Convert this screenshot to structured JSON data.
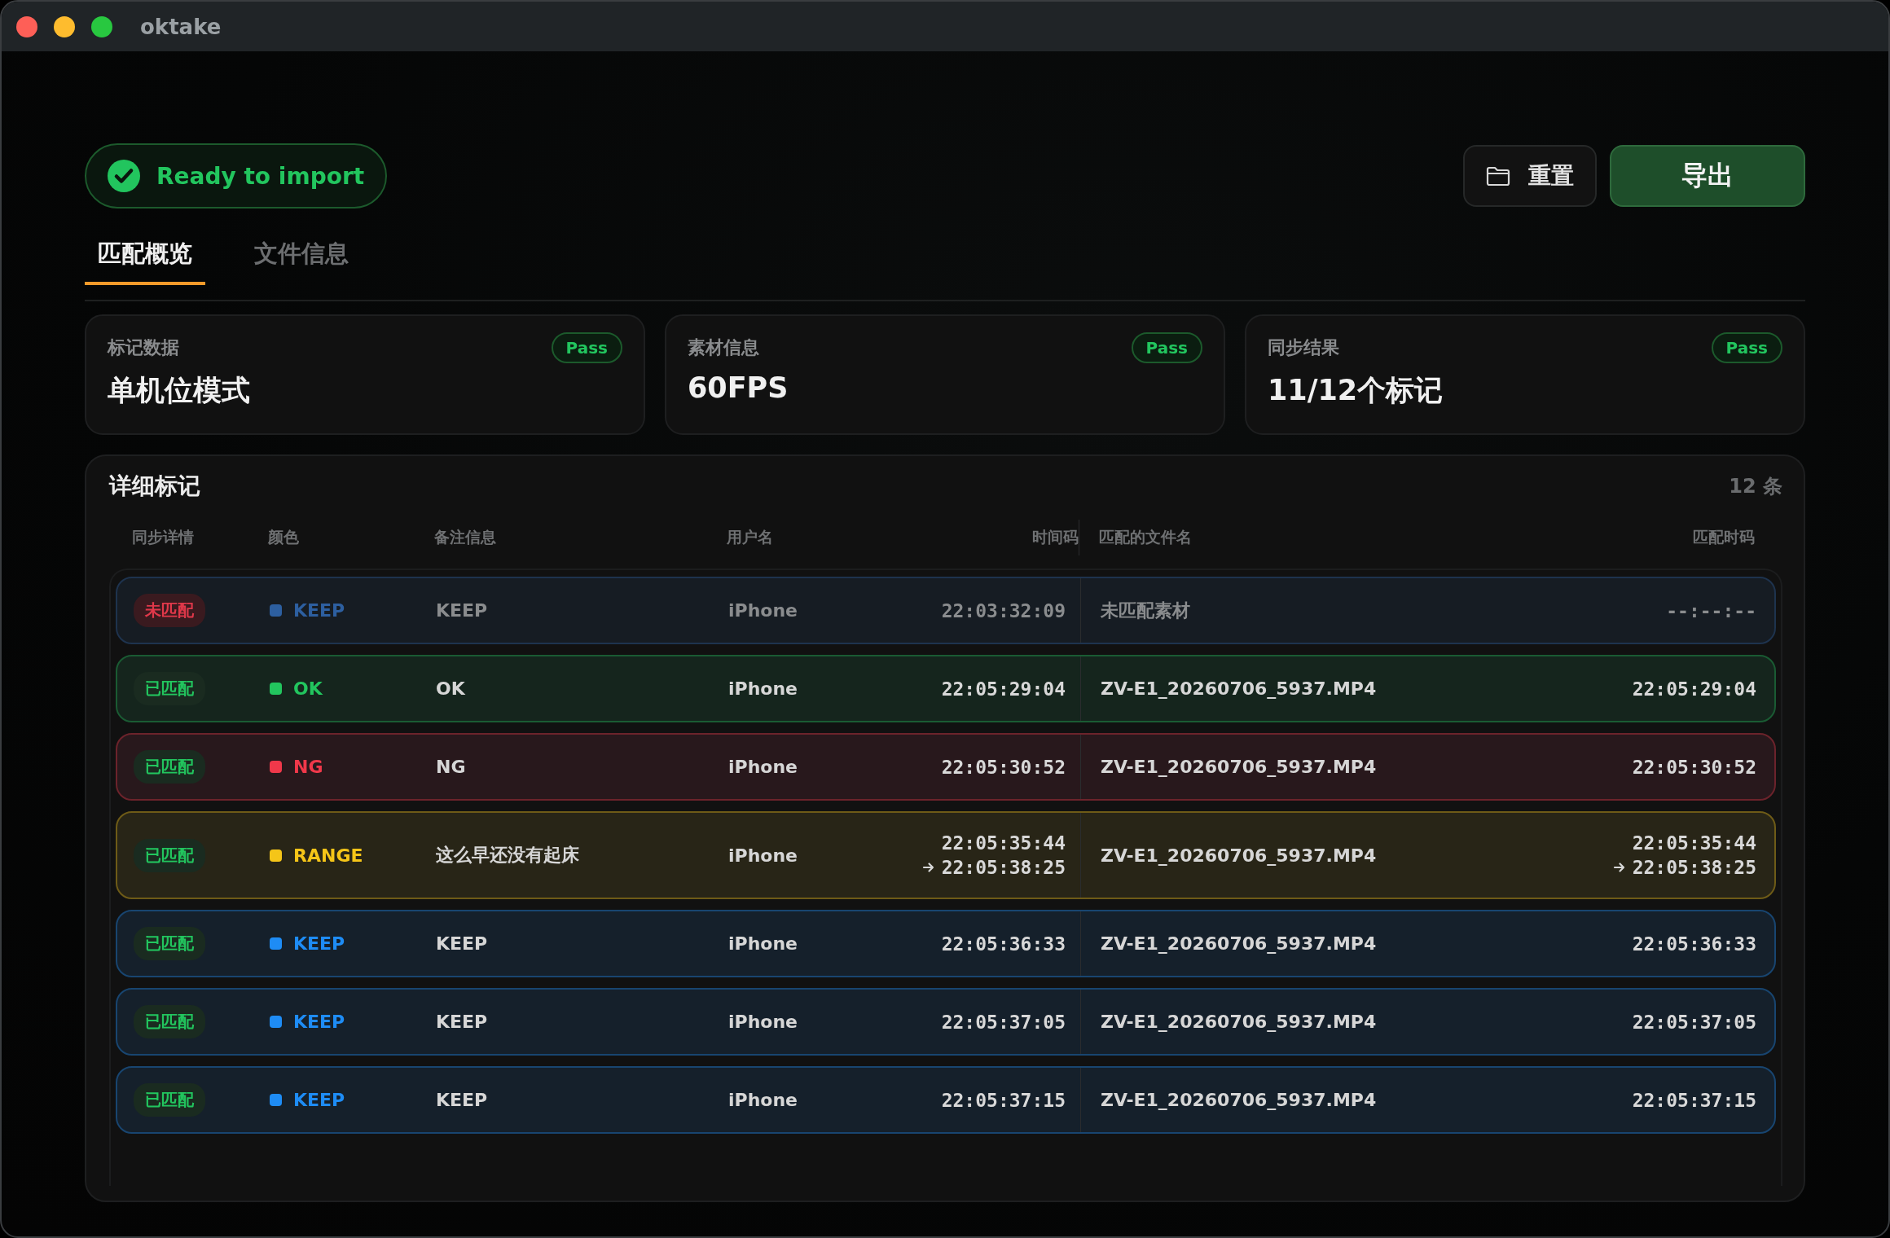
{
  "window": {
    "title": "oktake"
  },
  "status": {
    "label": "Ready to import"
  },
  "actions": [
    {
      "label": "重置",
      "kind": "secondary"
    },
    {
      "label": "导出",
      "kind": "primary"
    }
  ],
  "tabs": [
    {
      "label": "匹配概览",
      "selected": true
    },
    {
      "label": "文件信息",
      "selected": false
    }
  ],
  "summary_cards": [
    {
      "label": "标记数据",
      "badge": "Pass",
      "value": "单机位模式"
    },
    {
      "label": "素材信息",
      "badge": "Pass",
      "value": "60FPS"
    },
    {
      "label": "同步结果",
      "badge": "Pass",
      "value": "11/12个标记"
    }
  ],
  "markers": {
    "title": "详细标记",
    "count": "12 条",
    "columns": [
      "同步详情",
      "颜色",
      "备注信息",
      "用户名",
      "时间码",
      "匹配的文件名",
      "匹配时码"
    ],
    "rows": [
      {
        "sync": "未匹配",
        "matched": false,
        "color": "#2d5fa0",
        "color_label": "KEEP",
        "note": "KEEP",
        "user": "iPhone",
        "timecode": "22:03:32:09",
        "file": "未匹配素材",
        "matched_timecode": "--:--:--"
      },
      {
        "sync": "已匹配",
        "matched": true,
        "color": "#22c55e",
        "color_label": "OK",
        "note": "OK",
        "user": "iPhone",
        "timecode": "22:05:29:04",
        "file": "ZV-E1_20260706_5937.MP4",
        "matched_timecode": "22:05:29:04"
      },
      {
        "sync": "已匹配",
        "matched": true,
        "color": "#f0384a",
        "color_label": "NG",
        "note": "NG",
        "user": "iPhone",
        "timecode": "22:05:30:52",
        "file": "ZV-E1_20260706_5937.MP4",
        "matched_timecode": "22:05:30:52"
      },
      {
        "sync": "已匹配",
        "matched": true,
        "color": "#f5c518",
        "color_label": "RANGE",
        "note": "这么早还没有起床",
        "user": "iPhone",
        "timecode": "22:05:35:44",
        "timecode_end": "22:05:38:25",
        "file": "ZV-E1_20260706_5937.MP4",
        "matched_timecode": "22:05:35:44",
        "matched_timecode_end": "22:05:38:25"
      },
      {
        "sync": "已匹配",
        "matched": true,
        "color": "#1e8cf5",
        "color_label": "KEEP",
        "note": "KEEP",
        "user": "iPhone",
        "timecode": "22:05:36:33",
        "file": "ZV-E1_20260706_5937.MP4",
        "matched_timecode": "22:05:36:33"
      },
      {
        "sync": "已匹配",
        "matched": true,
        "color": "#1e8cf5",
        "color_label": "KEEP",
        "note": "KEEP",
        "user": "iPhone",
        "timecode": "22:05:37:05",
        "file": "ZV-E1_20260706_5937.MP4",
        "matched_timecode": "22:05:37:05"
      },
      {
        "sync": "已匹配",
        "matched": true,
        "color": "#1e8cf5",
        "color_label": "KEEP",
        "note": "KEEP",
        "user": "iPhone",
        "timecode": "22:05:37:15",
        "file": "ZV-E1_20260706_5937.MP4",
        "matched_timecode": "22:05:37:15"
      }
    ]
  }
}
